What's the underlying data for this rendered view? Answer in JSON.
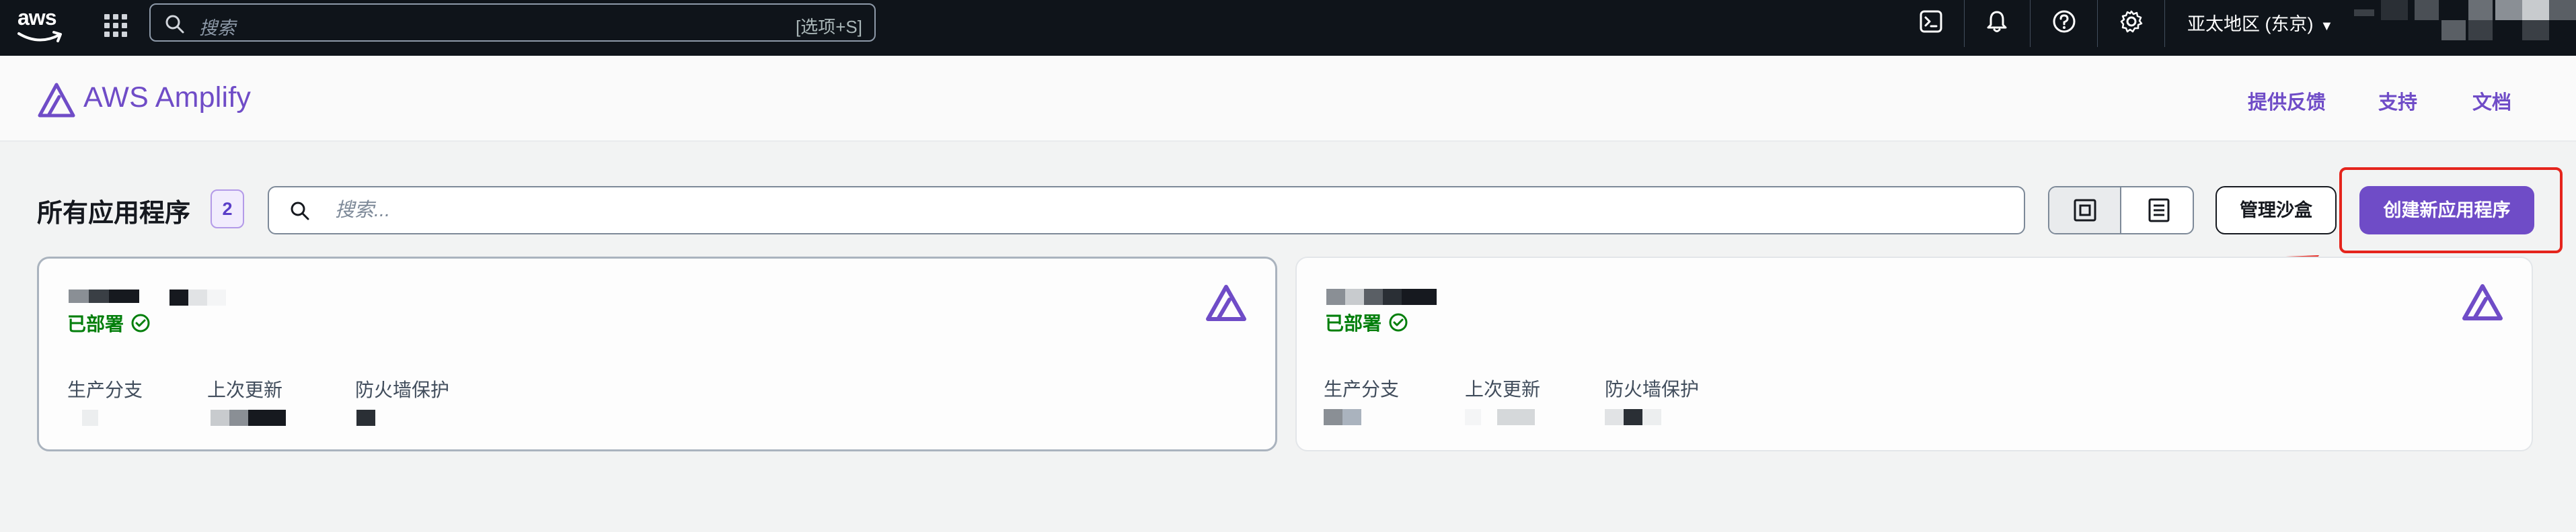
{
  "topbar": {
    "logo_text": "aws",
    "search_placeholder": "搜索",
    "search_shortcut": "[选项+S]",
    "region": "亚太地区 (东京)",
    "icons": [
      "cloudshell-icon",
      "bell-icon",
      "help-icon",
      "settings-icon"
    ]
  },
  "header": {
    "product_name": "AWS Amplify",
    "links": [
      "提供反馈",
      "支持",
      "文档"
    ]
  },
  "main": {
    "title": "所有应用程序",
    "app_count": "2",
    "search_placeholder": "搜索...",
    "view_modes": [
      "grid-view-icon",
      "list-view-icon"
    ],
    "sandbox_button": "管理沙盒",
    "create_button": "创建新应用程序"
  },
  "apps": [
    {
      "status": "已部署",
      "labels": {
        "branch": "生产分支",
        "updated": "上次更新",
        "firewall": "防火墙保护"
      }
    },
    {
      "status": "已部署",
      "labels": {
        "branch": "生产分支",
        "updated": "上次更新",
        "firewall": "防火墙保护"
      }
    }
  ],
  "colors": {
    "topbar": "#0f141a",
    "brand_purple": "#6f4cc7",
    "success_green": "#037f0c",
    "highlight_red": "#e5241c"
  }
}
